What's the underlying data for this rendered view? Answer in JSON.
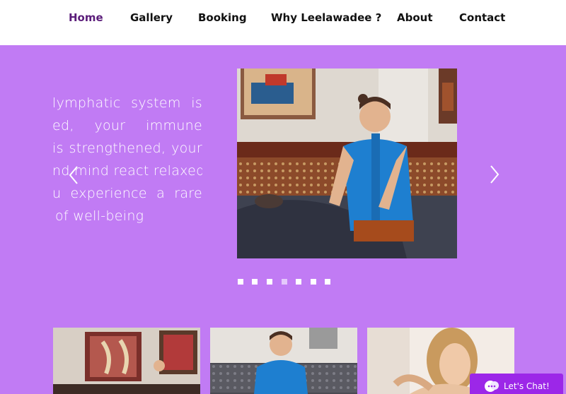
{
  "nav": {
    "items": [
      {
        "label": "Home",
        "active": true
      },
      {
        "label": "Gallery",
        "active": false
      },
      {
        "label": "Booking",
        "active": false
      },
      {
        "label": "Why Leelawadee ?",
        "active": false
      },
      {
        "label": "About",
        "active": false
      },
      {
        "label": "Contact",
        "active": false
      }
    ]
  },
  "hero": {
    "background_color": "#c17bf4",
    "text_lines": [
      "lymphatic system is",
      "ed, your immune",
      "is strengthened, your",
      "nd mind react relaxed",
      "u experience a rare",
      "of well-being"
    ],
    "prev_icon": "chevron-left-icon",
    "next_icon": "chevron-right-icon",
    "slide_image": "therapist-massage-photo",
    "slide_count": 7,
    "active_slide": 4
  },
  "thumbnails": [
    {
      "image": "massage-room-photo"
    },
    {
      "image": "therapist-blue-uniform-photo"
    },
    {
      "image": "woman-relaxing-photo"
    }
  ],
  "chat": {
    "label": "Let's Chat!",
    "icon": "chat-bubble-icon",
    "color": "#9c27e8"
  }
}
